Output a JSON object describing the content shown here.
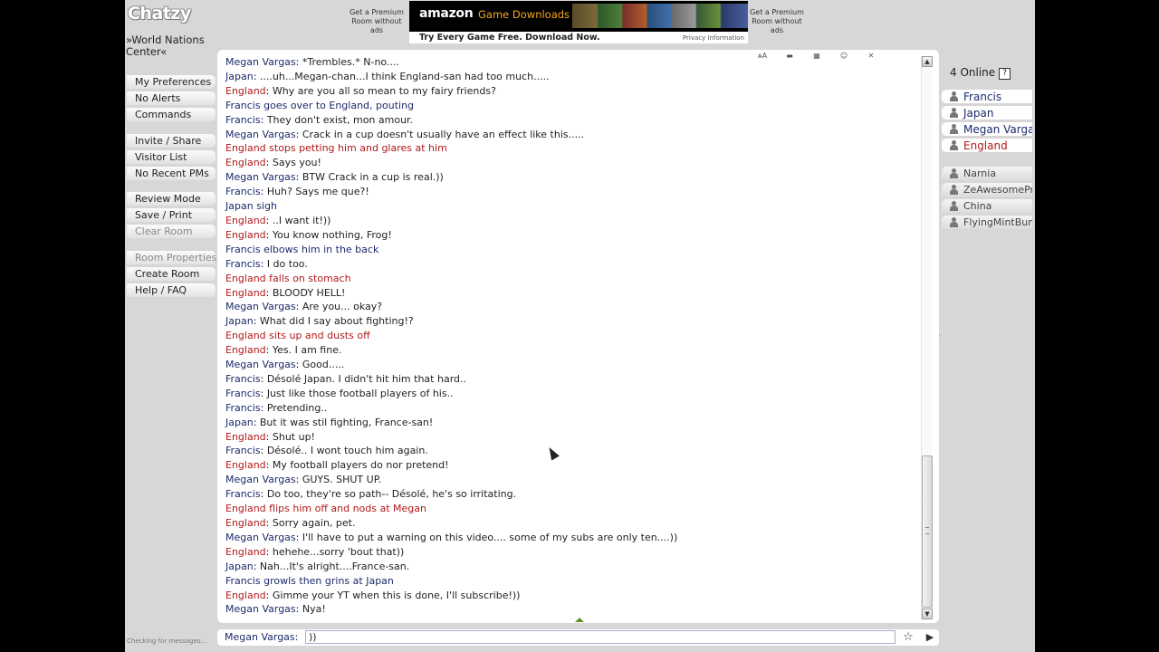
{
  "app": {
    "logo": "Chatzy",
    "room_name": "»World Nations Center«"
  },
  "ads": {
    "side_left": "Get a Premium Room without ads",
    "side_right": "Get a Premium Room without ads",
    "banner_brand": "amazon",
    "banner_sub": "Game Downloads",
    "banner_cta": "Try Every Game Free. Download Now.",
    "banner_privacy": "Privacy Information"
  },
  "menu": {
    "group1": [
      {
        "label": "My Preferences",
        "enabled": true
      },
      {
        "label": "No Alerts",
        "enabled": true
      },
      {
        "label": "Commands",
        "enabled": true
      }
    ],
    "group2": [
      {
        "label": "Invite / Share",
        "enabled": true
      },
      {
        "label": "Visitor List",
        "enabled": true
      },
      {
        "label": "No Recent PMs",
        "enabled": true
      }
    ],
    "group3": [
      {
        "label": "Review Mode",
        "enabled": true
      },
      {
        "label": "Save / Print",
        "enabled": true
      },
      {
        "label": "Clear Room",
        "enabled": false
      }
    ],
    "group4": [
      {
        "label": "Room Properties",
        "enabled": false
      },
      {
        "label": "Create Room",
        "enabled": true
      },
      {
        "label": "Help / FAQ",
        "enabled": true
      }
    ]
  },
  "toolbar": [
    "ᴀA",
    "▬",
    "▦",
    "☺",
    "✕"
  ],
  "messages": [
    {
      "name": "Megan Vargas",
      "sep": ": ",
      "text": "*Trembles.* N-no....",
      "action": false
    },
    {
      "name": "Japan",
      "sep": ": ",
      "text": "....uh...Megan-chan...I think England-san had too much.....",
      "action": false
    },
    {
      "name": "England",
      "sep": ": ",
      "text": "Why are you all so mean to my fairy friends?",
      "action": false
    },
    {
      "name": "Francis",
      "sep": " ",
      "text": "goes over to England, pouting",
      "action": true
    },
    {
      "name": "Francis",
      "sep": ": ",
      "text": "They don't exist, mon amour.",
      "action": false
    },
    {
      "name": "Megan Vargas",
      "sep": ": ",
      "text": "Crack in a cup doesn't usually have an effect like this.....",
      "action": false
    },
    {
      "name": "England",
      "sep": " ",
      "text": "stops petting him and glares at him",
      "action": true
    },
    {
      "name": "England",
      "sep": ": ",
      "text": "Says you!",
      "action": false
    },
    {
      "name": "Megan Vargas",
      "sep": ": ",
      "text": "BTW Crack in a cup is real.))",
      "action": false
    },
    {
      "name": "Francis",
      "sep": ": ",
      "text": "Huh? Says me que?!",
      "action": false
    },
    {
      "name": "Japan",
      "sep": " ",
      "text": "sigh",
      "action": true
    },
    {
      "name": "England",
      "sep": ": ",
      "text": "..I want it!))",
      "action": false
    },
    {
      "name": "England",
      "sep": ": ",
      "text": "You know nothing, Frog!",
      "action": false
    },
    {
      "name": "Francis",
      "sep": " ",
      "text": "elbows him in the back",
      "action": true
    },
    {
      "name": "Francis",
      "sep": ": ",
      "text": "I do too.",
      "action": false
    },
    {
      "name": "England",
      "sep": " ",
      "text": "falls on stomach",
      "action": true
    },
    {
      "name": "England",
      "sep": ": ",
      "text": "BLOODY HELL!",
      "action": false
    },
    {
      "name": "Megan Vargas",
      "sep": ": ",
      "text": "Are you... okay?",
      "action": false
    },
    {
      "name": "Japan",
      "sep": ": ",
      "text": "What did I say about fighting!?",
      "action": false
    },
    {
      "name": "England",
      "sep": " ",
      "text": "sits up and dusts off",
      "action": true
    },
    {
      "name": "England",
      "sep": ": ",
      "text": "Yes. I am fine.",
      "action": false
    },
    {
      "name": "Megan Vargas",
      "sep": ": ",
      "text": "Good.....",
      "action": false
    },
    {
      "name": "Francis",
      "sep": ": ",
      "text": "Désolé Japan. I didn't hit him that hard..",
      "action": false
    },
    {
      "name": "Francis",
      "sep": ": ",
      "text": "Just like those football players of his..",
      "action": false
    },
    {
      "name": "Francis",
      "sep": ": ",
      "text": "Pretending..",
      "action": false
    },
    {
      "name": "Japan",
      "sep": ": ",
      "text": "But it was stil fighting, France-san!",
      "action": false
    },
    {
      "name": "England",
      "sep": ": ",
      "text": "Shut up!",
      "action": false
    },
    {
      "name": "Francis",
      "sep": ": ",
      "text": "Désolé.. I wont touch him again.",
      "action": false
    },
    {
      "name": "England",
      "sep": ": ",
      "text": "My football players do nor pretend!",
      "action": false
    },
    {
      "name": "Megan Vargas",
      "sep": ": ",
      "text": "GUYS. SHUT UP.",
      "action": false
    },
    {
      "name": "Francis",
      "sep": ": ",
      "text": "Do too, they're so path-- Désolé, he's so irritating.",
      "action": false
    },
    {
      "name": "England",
      "sep": " ",
      "text": "flips him off and nods at Megan",
      "action": true
    },
    {
      "name": "England",
      "sep": ": ",
      "text": "Sorry again, pet.",
      "action": false
    },
    {
      "name": "Megan Vargas",
      "sep": ": ",
      "text": "I'll have to put a warning on this video.... some of my subs are only ten....))",
      "action": false
    },
    {
      "name": "England",
      "sep": ": ",
      "text": "hehehe...sorry 'bout that))",
      "action": false
    },
    {
      "name": "Japan",
      "sep": ": ",
      "text": "Nah...It's alright....France-san.",
      "action": false
    },
    {
      "name": "Francis",
      "sep": " ",
      "text": "growls then grins at Japan",
      "action": true
    },
    {
      "name": "England",
      "sep": ": ",
      "text": "Gimme your YT when this is done, I'll subscribe!))",
      "action": false
    },
    {
      "name": "Megan Vargas",
      "sep": ": ",
      "text": "Nya!",
      "action": false
    }
  ],
  "input": {
    "name_label": "Megan Vargas:",
    "value": "))",
    "star_icon": "star-icon",
    "send_icon": "play-icon"
  },
  "status": "Checking for messages...",
  "online": {
    "header": "4 Online",
    "help": "?",
    "present": [
      {
        "name": "Francis",
        "color": "#1c2a6a"
      },
      {
        "name": "Japan",
        "color": "#1c2a6a"
      },
      {
        "name": "Megan Varga",
        "color": "#1c2a6a"
      },
      {
        "name": "England",
        "color": "#b21a1a"
      }
    ],
    "absent": [
      {
        "name": "Narnia"
      },
      {
        "name": "ZeAwesomePru"
      },
      {
        "name": "China"
      },
      {
        "name": "FlyingMintBunn"
      }
    ]
  },
  "colors": {
    "england": "#b21a1a",
    "default_name": "#1c2a6a",
    "background": "#d7d7d7"
  }
}
